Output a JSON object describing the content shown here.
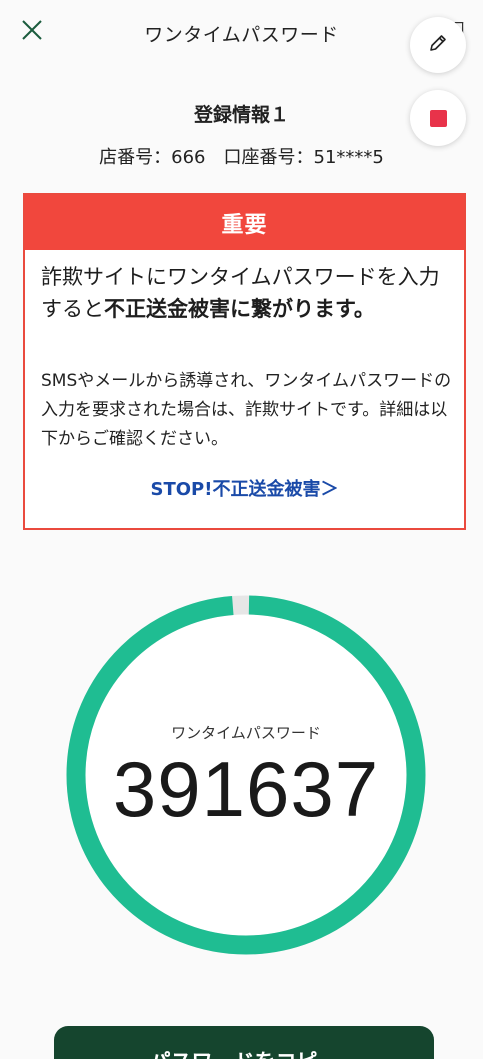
{
  "header": {
    "title": "ワンタイムパスワード"
  },
  "registration": {
    "title": "登録情報１",
    "info": "店番号：666　口座番号：51****5"
  },
  "alert": {
    "heading": "重要",
    "main_part1": "詐欺サイトにワンタイムパスワードを入力すると",
    "main_bold1": "不正送金被害に繋がりま",
    "main_bold2": "す。",
    "sub_text": "SMSやメールから誘導され、ワンタイムパスワードの入力を要求された場合は、詐欺サイトです。詳細は以下からご確認ください。",
    "link_label": "STOP!不正送金被害＞"
  },
  "otp": {
    "label": "ワンタイムパスワード",
    "value": "391637",
    "remaining_fraction": 0.99
  },
  "copy_button": {
    "label": "パスワードをコピー"
  },
  "colors": {
    "alert_red": "#f1473d",
    "ring_green": "#1fbd92",
    "button_dark_green": "#15452e",
    "link_blue": "#1a4aa8",
    "stop_red": "#e8334a"
  }
}
